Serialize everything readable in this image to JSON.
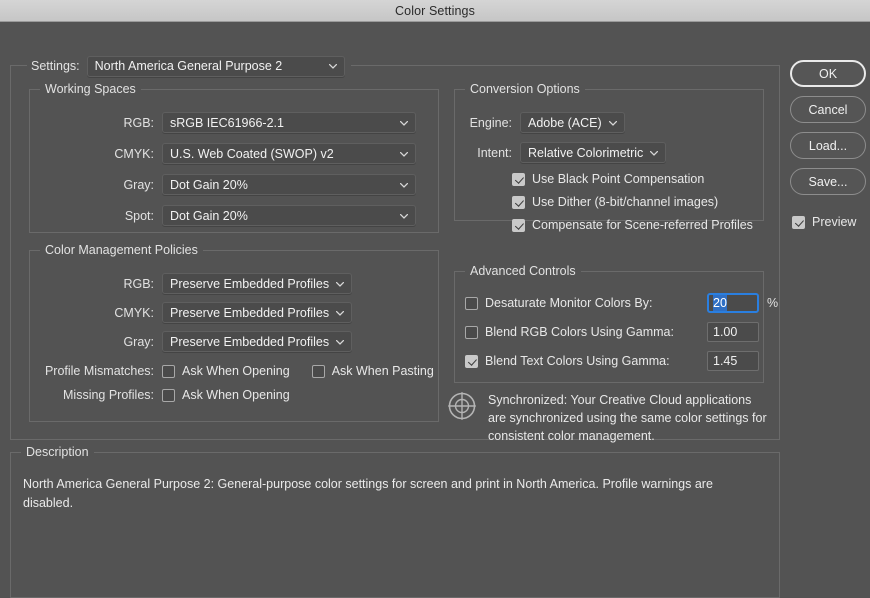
{
  "window": {
    "title": "Color Settings"
  },
  "settings": {
    "label": "Settings:",
    "value": "North America General Purpose 2"
  },
  "working_spaces": {
    "legend": "Working Spaces",
    "rows": [
      {
        "label": "RGB:",
        "value": "sRGB IEC61966-2.1"
      },
      {
        "label": "CMYK:",
        "value": "U.S. Web Coated (SWOP) v2"
      },
      {
        "label": "Gray:",
        "value": "Dot Gain 20%"
      },
      {
        "label": "Spot:",
        "value": "Dot Gain 20%"
      }
    ]
  },
  "color_management_policies": {
    "legend": "Color Management Policies",
    "rows": [
      {
        "label": "RGB:",
        "value": "Preserve Embedded Profiles"
      },
      {
        "label": "CMYK:",
        "value": "Preserve Embedded Profiles"
      },
      {
        "label": "Gray:",
        "value": "Preserve Embedded Profiles"
      }
    ],
    "profile_mismatches_label": "Profile Mismatches:",
    "mismatch_open_label": "Ask When Opening",
    "mismatch_open_checked": false,
    "mismatch_paste_label": "Ask When Pasting",
    "mismatch_paste_checked": false,
    "missing_profiles_label": "Missing Profiles:",
    "missing_open_label": "Ask When Opening",
    "missing_open_checked": false
  },
  "conversion_options": {
    "legend": "Conversion Options",
    "engine_label": "Engine:",
    "engine_value": "Adobe (ACE)",
    "intent_label": "Intent:",
    "intent_value": "Relative Colorimetric",
    "black_point_label": "Use Black Point Compensation",
    "black_point_checked": true,
    "dither_label": "Use Dither (8-bit/channel images)",
    "dither_checked": true,
    "scene_referred_label": "Compensate for Scene-referred Profiles",
    "scene_referred_checked": true
  },
  "advanced_controls": {
    "legend": "Advanced Controls",
    "desaturate_label": "Desaturate Monitor Colors By:",
    "desaturate_checked": false,
    "desaturate_value": "20",
    "percent_label": "%",
    "blend_rgb_label": "Blend RGB Colors Using Gamma:",
    "blend_rgb_checked": false,
    "blend_rgb_value": "1.00",
    "blend_text_label": "Blend Text Colors Using Gamma:",
    "blend_text_checked": true,
    "blend_text_value": "1.45"
  },
  "sync_status": {
    "text": "Synchronized: Your Creative Cloud applications are synchronized using the same color settings for consistent color management."
  },
  "buttons": {
    "ok": "OK",
    "cancel": "Cancel",
    "load": "Load...",
    "save": "Save...",
    "preview_label": "Preview",
    "preview_checked": true
  },
  "description": {
    "legend": "Description",
    "text": "North America General Purpose 2:  General-purpose color settings for screen and print in North America. Profile warnings are disabled."
  },
  "colors": {
    "background": "#535353",
    "field": "#4b4b4b",
    "accent_focus": "#2a7fe0",
    "selection": "#2f6fc4",
    "text": "#e8e8e8",
    "titlebar": "#c6c6c6"
  }
}
